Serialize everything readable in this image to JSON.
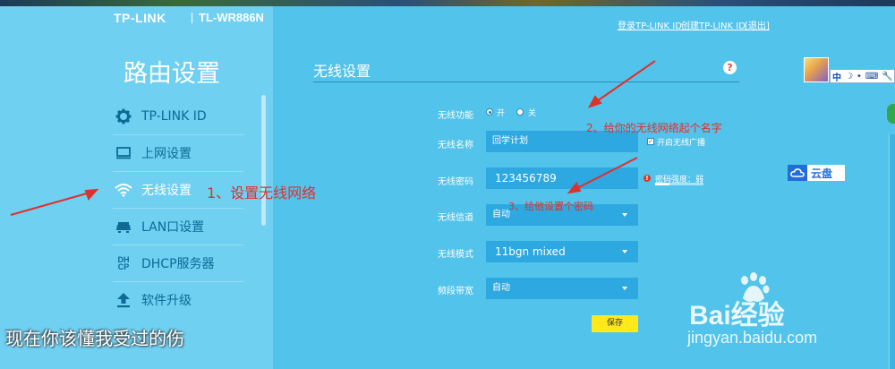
{
  "header": {
    "brand": "TP-LINK",
    "model": "TL-WR886N",
    "links": [
      "登录TP-LINK ID",
      "创建TP-LINK ID",
      "[退出]"
    ]
  },
  "sidebar": {
    "title": "路由设置",
    "items": [
      {
        "label": "TP-LINK ID",
        "icon": "gear-icon",
        "active": false
      },
      {
        "label": "上网设置",
        "icon": "monitor-icon",
        "active": false
      },
      {
        "label": "无线设置",
        "icon": "wifi-icon",
        "active": true
      },
      {
        "label": "LAN口设置",
        "icon": "router-icon",
        "active": false
      },
      {
        "label": "DHCP服务器",
        "icon": "dhcp-icon",
        "active": false
      },
      {
        "label": "软件升级",
        "icon": "upload-icon",
        "active": false
      }
    ]
  },
  "main": {
    "title": "无线设置",
    "help_icon": "help-icon",
    "wireless_switch": {
      "label": "无线功能",
      "on_label": "开",
      "off_label": "关",
      "selected": "on"
    },
    "ssid": {
      "label": "无线名称",
      "value": "回学计划",
      "broadcast_label": "开启无线广播",
      "broadcast_checked": true
    },
    "password": {
      "label": "无线密码",
      "value": "123456789",
      "strength_label": "密码强度：弱",
      "strength_level": 0.3
    },
    "channel": {
      "label": "无线信道",
      "value": "自动"
    },
    "mode": {
      "label": "无线模式",
      "value": "11bgn mixed"
    },
    "bandwidth": {
      "label": "频段带宽",
      "value": "自动"
    },
    "save_label": "保存"
  },
  "annotations": {
    "step1": "1、设置无线网络",
    "step2": "2、给你的无线网络起个名字",
    "step3": "3、给他设置个密码",
    "step1_prefix": ">",
    "color": "#e0302a"
  },
  "overlay": {
    "caption": "现在你该懂我受过的伤",
    "cloud_label": "云盘",
    "ime_label": "中",
    "watermark_logo": "Bai经验",
    "watermark_url": "jingyan.baidu.com"
  }
}
